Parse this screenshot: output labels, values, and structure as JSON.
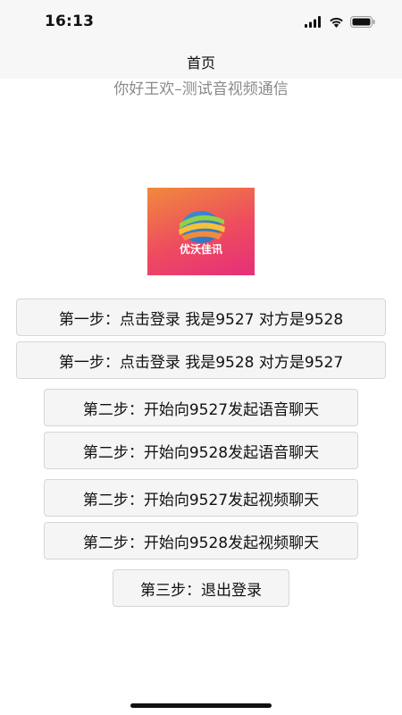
{
  "status_bar": {
    "time": "16:13",
    "icons": [
      "cellular-signal-icon",
      "wifi-icon",
      "battery-icon"
    ]
  },
  "nav": {
    "title": "首页"
  },
  "greeting": "你好王欢–测试音视频通信",
  "logo": {
    "text": "优沃佳讯",
    "gradient_colors": [
      "#f08a3c",
      "#ee4b5f",
      "#e52f7a"
    ]
  },
  "buttons": {
    "login_9527": "第一步：点击登录 我是9527 对方是9528",
    "login_9528": "第一步：点击登录 我是9528 对方是9527",
    "voice_to_9527": "第二步：开始向9527发起语音聊天",
    "voice_to_9528": "第二步：开始向9528发起语音聊天",
    "video_to_9527": "第二步：开始向9527发起视频聊天",
    "video_to_9528": "第二步：开始向9528发起视频聊天",
    "logout": "第三步：退出登录"
  }
}
